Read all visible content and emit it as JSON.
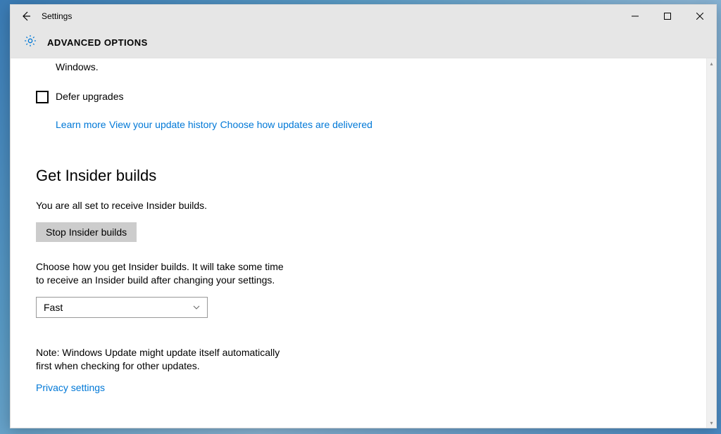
{
  "titlebar": {
    "app_name": "Settings"
  },
  "header": {
    "title": "ADVANCED OPTIONS"
  },
  "content": {
    "truncated_line": "Windows.",
    "defer": {
      "label": "Defer upgrades",
      "learn_more": "Learn more"
    },
    "links": {
      "history": "View your update history",
      "delivered": "Choose how updates are delivered"
    },
    "insider": {
      "heading": "Get Insider builds",
      "status": "You are all set to receive Insider builds.",
      "stop_button": "Stop Insider builds",
      "choose_text": "Choose how you get Insider builds. It will take some time to receive an Insider build after changing your settings.",
      "ring_selected": "Fast",
      "note": "Note: Windows Update might update itself automatically first when checking for other updates.",
      "privacy": "Privacy settings"
    }
  }
}
